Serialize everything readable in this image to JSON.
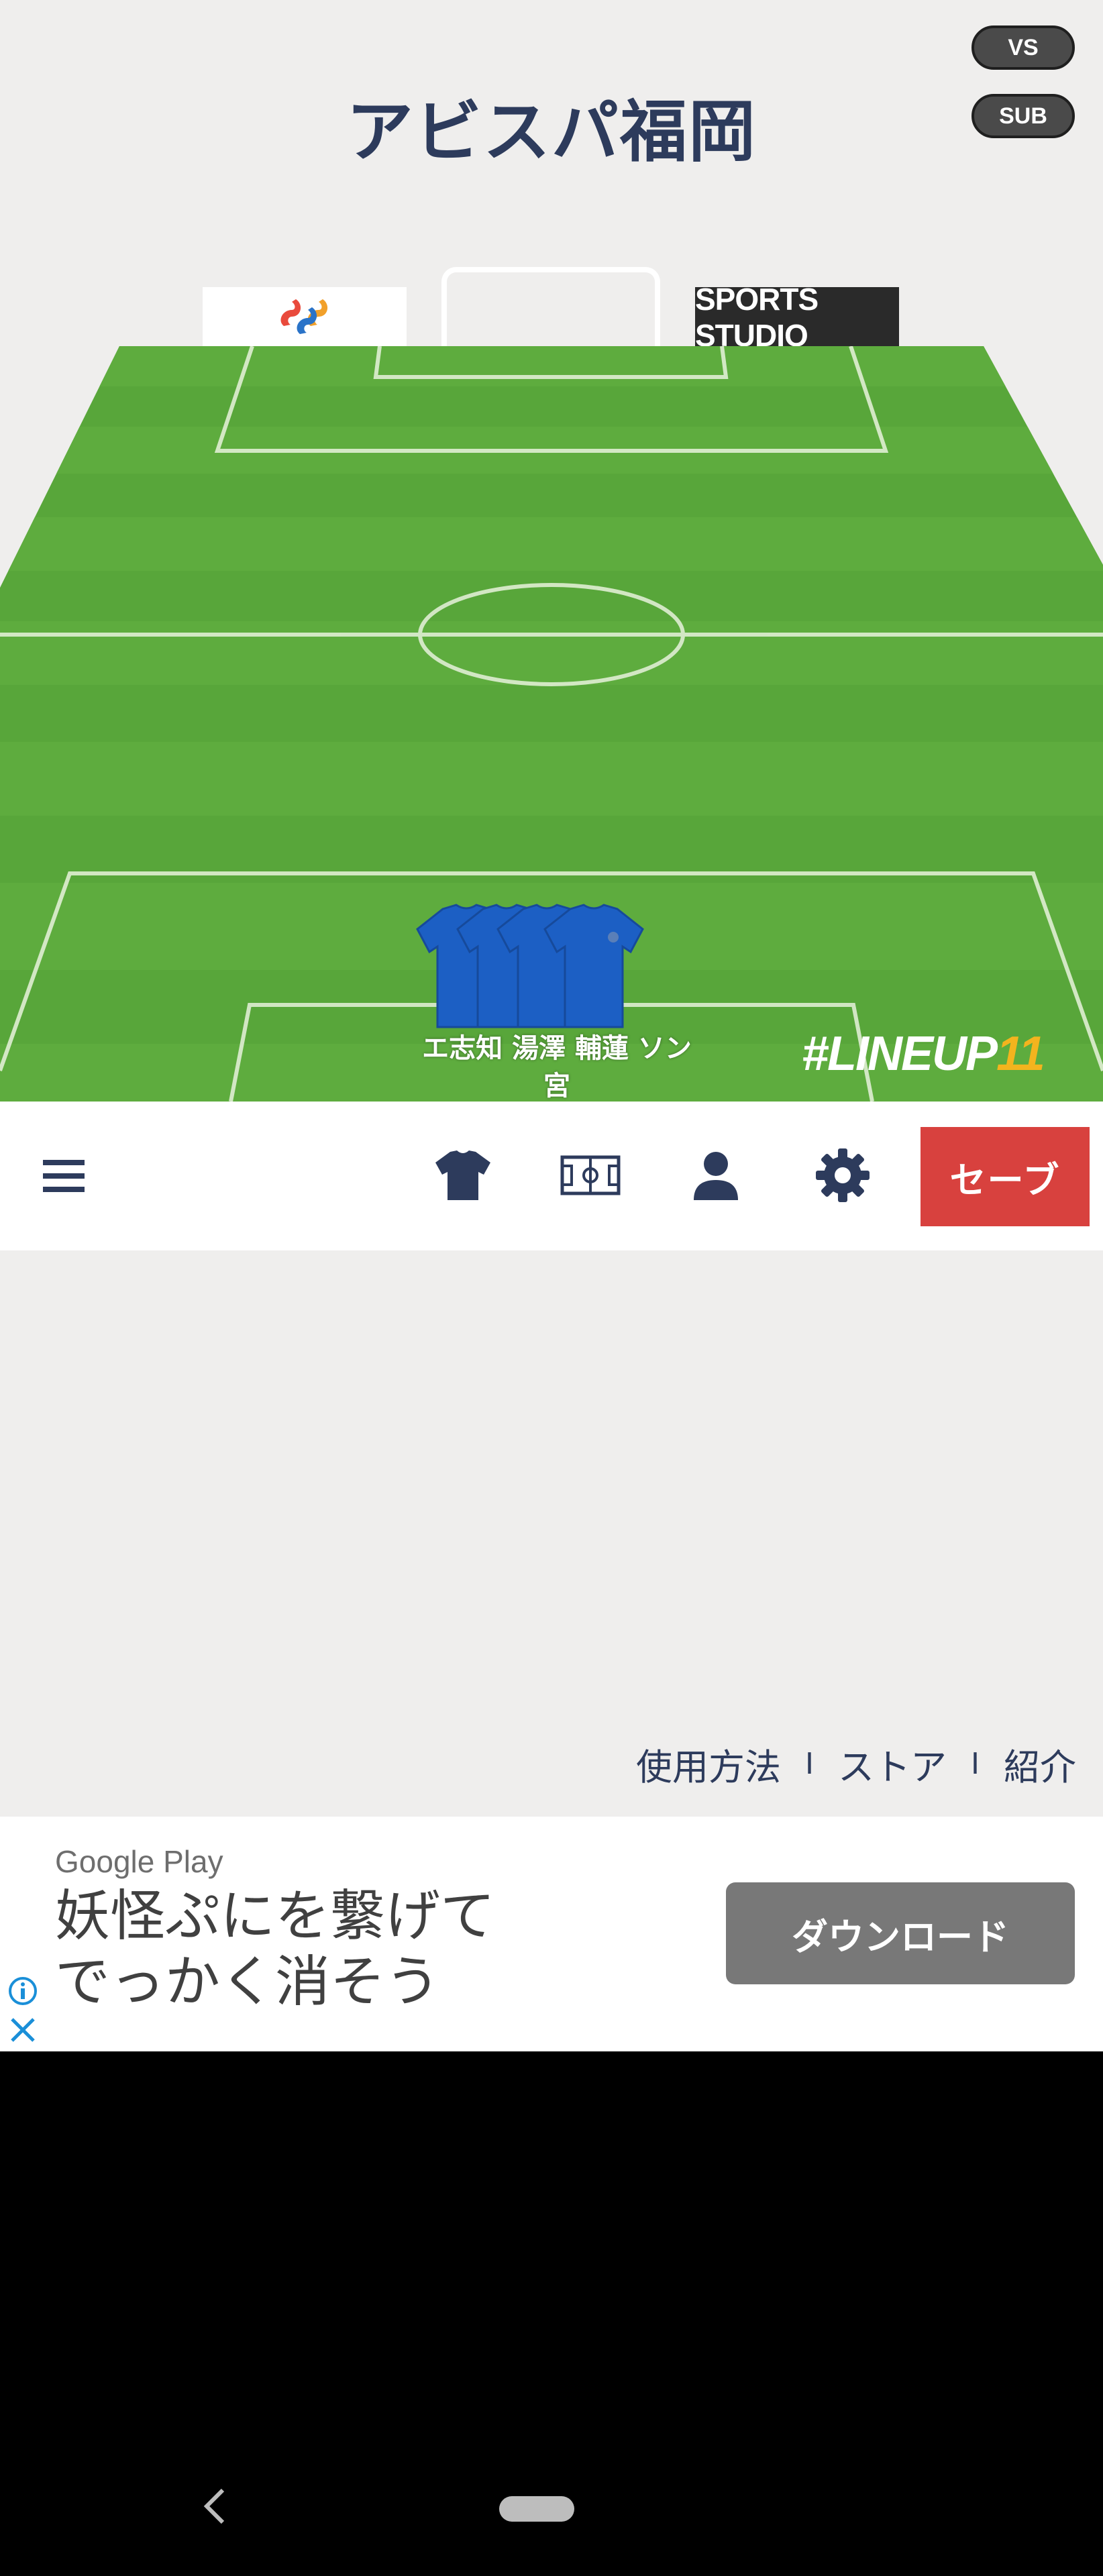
{
  "header": {
    "team_name": "アビスパ福岡",
    "vs_label": "VS",
    "sub_label": "SUB"
  },
  "sponsors": {
    "left_logo": "ss-logo",
    "right_label": "SPORTS STUDIO"
  },
  "pitch": {
    "watermark_prefix": "#LINEUP",
    "watermark_number": "11",
    "players_line1": "エ志知 湯澤 輔蓮 ソン",
    "players_line2": "宮",
    "colors": {
      "grass": "#58a63a",
      "jersey": "#1c5fc4"
    }
  },
  "toolbar": {
    "menu_icon": "hamburger-icon",
    "jersey_icon": "jersey-icon",
    "field_icon": "field-icon",
    "person_icon": "person-icon",
    "settings_icon": "gear-icon",
    "save_label": "セーブ",
    "save_color": "#d8413e"
  },
  "footer": {
    "links": [
      "使用方法",
      "ストア",
      "紹介"
    ],
    "separator": "I"
  },
  "ad": {
    "source": "Google Play",
    "text_line1": "妖怪ぷにを繋げて",
    "text_line2": "でっかく消そう",
    "button_label": "ダウンロード"
  }
}
